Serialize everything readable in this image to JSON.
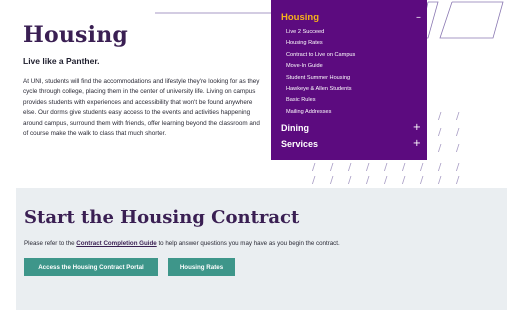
{
  "hero": {
    "title": "Housing",
    "subtitle": "Live like a Panther.",
    "body": "At UNI, students will find the accommodations and lifestyle they're looking for as they cycle through college, placing them in the center of university life. Living on campus provides students with experiences and accessibility that won't be found anywhere else. Our dorms give students easy access to the events and activities happening around campus, surround them with friends, offer learning beyond the classroom and of course make the walk to class that much shorter."
  },
  "menu": {
    "housing_label": "Housing",
    "housing_toggle": "–",
    "housing_items": [
      "Live 2 Succeed",
      "Housing Rates",
      "Contract to Live on Campus",
      "Move-In Guide",
      "Student Summer Housing",
      "Hawkeye & Allen Students",
      "Basic Rules",
      "Mailing Addresses"
    ],
    "dining_label": "Dining",
    "dining_toggle": "+",
    "services_label": "Services",
    "services_toggle": "+"
  },
  "contract": {
    "title": "Start the Housing Contract",
    "text_before": "Please refer to the ",
    "link_label": "Contract Completion Guide",
    "text_after": " to help answer questions you may have as you begin the contract.",
    "portal_button": "Access the Housing Contract Portal",
    "rates_button": "Housing Rates"
  },
  "colors": {
    "menu_bg": "#5c0b7f",
    "menu_active": "#f6b21b",
    "title": "#3a1f53",
    "button": "#3e968a",
    "section_bg": "#eaeef1"
  }
}
